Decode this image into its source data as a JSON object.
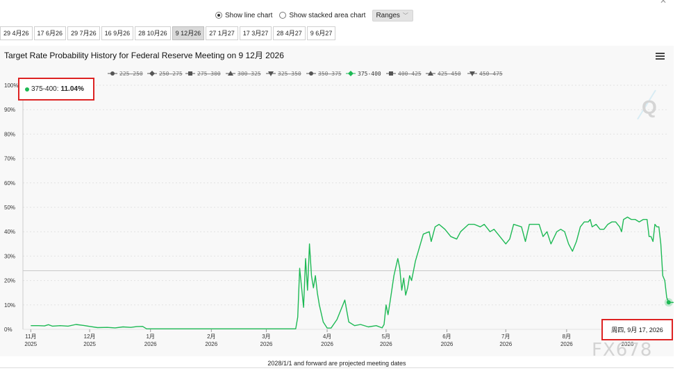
{
  "controls": {
    "line_label": "Show line chart",
    "stacked_label": "Show stacked area chart",
    "ranges_label": "Ranges",
    "selected_view": "line"
  },
  "tabs": [
    "29 4月26",
    "17 6月26",
    "29 7月26",
    "16 9月26",
    "28 10月26",
    "9 12月26",
    "27 1月27",
    "17 3月27",
    "28 4月27",
    "9 6月27"
  ],
  "active_tab_index": 5,
  "tooltip": {
    "series": "375-400:",
    "value": "11.04%"
  },
  "crosshair_label": "周四, 9月 17, 2026",
  "footnote": "2028/1/1 and forward are projected meeting dates",
  "watermark": "FX678",
  "colors": {
    "series_active": "#1db954",
    "inactive": "#999999",
    "highlight_box": "#dd2222"
  },
  "chart_data": {
    "type": "line",
    "title": "Target Rate Probability History for Federal Reserve Meeting on 9 12月 2026",
    "y_unit": "%",
    "ylim": [
      0,
      100
    ],
    "y_ticks": [
      0,
      10,
      20,
      30,
      40,
      50,
      60,
      70,
      80,
      90,
      100
    ],
    "y_tick_labels": [
      "0%",
      "10%",
      "20%",
      "30%",
      "40%",
      "50%",
      "60%",
      "70%",
      "80%",
      "90%",
      "100%"
    ],
    "x_ticks": [
      {
        "date": "2025-11-01",
        "month": "11月",
        "year": "2025"
      },
      {
        "date": "2025-12-01",
        "month": "12月",
        "year": "2025"
      },
      {
        "date": "2026-01-01",
        "month": "1月",
        "year": "2026"
      },
      {
        "date": "2026-02-01",
        "month": "2月",
        "year": "2026"
      },
      {
        "date": "2026-03-01",
        "month": "3月",
        "year": "2026"
      },
      {
        "date": "2026-04-01",
        "month": "4月",
        "year": "2026"
      },
      {
        "date": "2026-05-01",
        "month": "5月",
        "year": "2026"
      },
      {
        "date": "2026-06-01",
        "month": "6月",
        "year": "2026"
      },
      {
        "date": "2026-07-01",
        "month": "7月",
        "year": "2026"
      },
      {
        "date": "2026-08-01",
        "month": "8月",
        "year": "2026"
      },
      {
        "date": "2026-09-01",
        "month": "9月",
        "year": "2026"
      }
    ],
    "xlim": [
      "2025-10-28",
      "2026-09-21"
    ],
    "legend_position": "top",
    "grid": true,
    "highlighted_date": "2026-09-17",
    "reference_line_value": 24,
    "legend": [
      {
        "name": "225-250",
        "marker": "circle",
        "active": false
      },
      {
        "name": "250-275",
        "marker": "diamond",
        "active": false
      },
      {
        "name": "275-300",
        "marker": "square",
        "active": false
      },
      {
        "name": "300-325",
        "marker": "triangle",
        "active": false
      },
      {
        "name": "325-350",
        "marker": "triangle-down",
        "active": false
      },
      {
        "name": "350-375",
        "marker": "circle",
        "active": false
      },
      {
        "name": "375-400",
        "marker": "diamond",
        "active": true
      },
      {
        "name": "400-425",
        "marker": "square",
        "active": false
      },
      {
        "name": "425-450",
        "marker": "triangle",
        "active": false
      },
      {
        "name": "450-475",
        "marker": "triangle-down",
        "active": false
      }
    ],
    "series": [
      {
        "name": "375-400",
        "points": [
          [
            "2025-11-01",
            1.5
          ],
          [
            "2025-11-05",
            1.5
          ],
          [
            "2025-11-08",
            1.4
          ],
          [
            "2025-11-10",
            1.9
          ],
          [
            "2025-11-12",
            1.3
          ],
          [
            "2025-11-16",
            1.5
          ],
          [
            "2025-11-20",
            1.3
          ],
          [
            "2025-11-24",
            2.0
          ],
          [
            "2025-11-28",
            1.6
          ],
          [
            "2025-12-01",
            1.2
          ],
          [
            "2025-12-05",
            0.7
          ],
          [
            "2025-12-10",
            0.8
          ],
          [
            "2025-12-14",
            0.6
          ],
          [
            "2025-12-18",
            1.0
          ],
          [
            "2025-12-22",
            0.8
          ],
          [
            "2025-12-25",
            1.1
          ],
          [
            "2025-12-28",
            1.2
          ],
          [
            "2025-12-30",
            0.2
          ],
          [
            "2026-01-10",
            0.2
          ],
          [
            "2026-02-01",
            0.2
          ],
          [
            "2026-03-01",
            0.2
          ],
          [
            "2026-03-16",
            0.2
          ],
          [
            "2026-03-17",
            5
          ],
          [
            "2026-03-18",
            25
          ],
          [
            "2026-03-19",
            17
          ],
          [
            "2026-03-20",
            9
          ],
          [
            "2026-03-21",
            29
          ],
          [
            "2026-03-22",
            16
          ],
          [
            "2026-03-23",
            35
          ],
          [
            "2026-03-24",
            22
          ],
          [
            "2026-03-25",
            17
          ],
          [
            "2026-03-26",
            22
          ],
          [
            "2026-03-27",
            15
          ],
          [
            "2026-03-28",
            10
          ],
          [
            "2026-03-30",
            3
          ],
          [
            "2026-04-01",
            0.5
          ],
          [
            "2026-04-03",
            0.5
          ],
          [
            "2026-04-06",
            4
          ],
          [
            "2026-04-10",
            12
          ],
          [
            "2026-04-12",
            3
          ],
          [
            "2026-04-15",
            1.5
          ],
          [
            "2026-04-18",
            2
          ],
          [
            "2026-04-22",
            1
          ],
          [
            "2026-04-26",
            1.5
          ],
          [
            "2026-04-29",
            0.6
          ],
          [
            "2026-04-30",
            2
          ],
          [
            "2026-05-01",
            10
          ],
          [
            "2026-05-02",
            6
          ],
          [
            "2026-05-03",
            11
          ],
          [
            "2026-05-05",
            22
          ],
          [
            "2026-05-07",
            29
          ],
          [
            "2026-05-08",
            25
          ],
          [
            "2026-05-09",
            16
          ],
          [
            "2026-05-10",
            21
          ],
          [
            "2026-05-11",
            14
          ],
          [
            "2026-05-12",
            17
          ],
          [
            "2026-05-13",
            22
          ],
          [
            "2026-05-14",
            20
          ],
          [
            "2026-05-16",
            28
          ],
          [
            "2026-05-20",
            39
          ],
          [
            "2026-05-23",
            40
          ],
          [
            "2026-05-24",
            36
          ],
          [
            "2026-05-26",
            42
          ],
          [
            "2026-05-28",
            43
          ],
          [
            "2026-05-31",
            41
          ],
          [
            "2026-06-03",
            38
          ],
          [
            "2026-06-06",
            37
          ],
          [
            "2026-06-08",
            40
          ],
          [
            "2026-06-12",
            43
          ],
          [
            "2026-06-15",
            43
          ],
          [
            "2026-06-18",
            42
          ],
          [
            "2026-06-20",
            43
          ],
          [
            "2026-06-23",
            40
          ],
          [
            "2026-06-25",
            41
          ],
          [
            "2026-06-28",
            38
          ],
          [
            "2026-07-01",
            35
          ],
          [
            "2026-07-03",
            37
          ],
          [
            "2026-07-05",
            43
          ],
          [
            "2026-07-09",
            42
          ],
          [
            "2026-07-11",
            36
          ],
          [
            "2026-07-13",
            43
          ],
          [
            "2026-07-16",
            43
          ],
          [
            "2026-07-18",
            43
          ],
          [
            "2026-07-20",
            38
          ],
          [
            "2026-07-22",
            40
          ],
          [
            "2026-07-24",
            35
          ],
          [
            "2026-07-27",
            40
          ],
          [
            "2026-07-29",
            41
          ],
          [
            "2026-07-31",
            40
          ],
          [
            "2026-08-02",
            35
          ],
          [
            "2026-08-04",
            32
          ],
          [
            "2026-08-06",
            36
          ],
          [
            "2026-08-08",
            42
          ],
          [
            "2026-08-10",
            44
          ],
          [
            "2026-08-12",
            44
          ],
          [
            "2026-08-13",
            45
          ],
          [
            "2026-08-14",
            42
          ],
          [
            "2026-08-16",
            43
          ],
          [
            "2026-08-18",
            41
          ],
          [
            "2026-08-20",
            41
          ],
          [
            "2026-08-22",
            43
          ],
          [
            "2026-08-24",
            44
          ],
          [
            "2026-08-26",
            44
          ],
          [
            "2026-08-28",
            42
          ],
          [
            "2026-08-29",
            40
          ],
          [
            "2026-08-30",
            45
          ],
          [
            "2026-09-01",
            46
          ],
          [
            "2026-09-03",
            45
          ],
          [
            "2026-09-05",
            45
          ],
          [
            "2026-09-07",
            44
          ],
          [
            "2026-09-09",
            45
          ],
          [
            "2026-09-11",
            45
          ],
          [
            "2026-09-12",
            38
          ],
          [
            "2026-09-13",
            38
          ],
          [
            "2026-09-14",
            36
          ],
          [
            "2026-09-15",
            43
          ],
          [
            "2026-09-16",
            42
          ],
          [
            "2026-09-17",
            42
          ],
          [
            "2026-09-18",
            35
          ],
          [
            "2026-09-19",
            22
          ],
          [
            "2026-09-20",
            20
          ],
          [
            "2026-09-21",
            13
          ],
          [
            "2026-09-22",
            11.04
          ],
          [
            "2026-09-25",
            11
          ],
          [
            "2026-09-28",
            11
          ]
        ]
      }
    ]
  }
}
